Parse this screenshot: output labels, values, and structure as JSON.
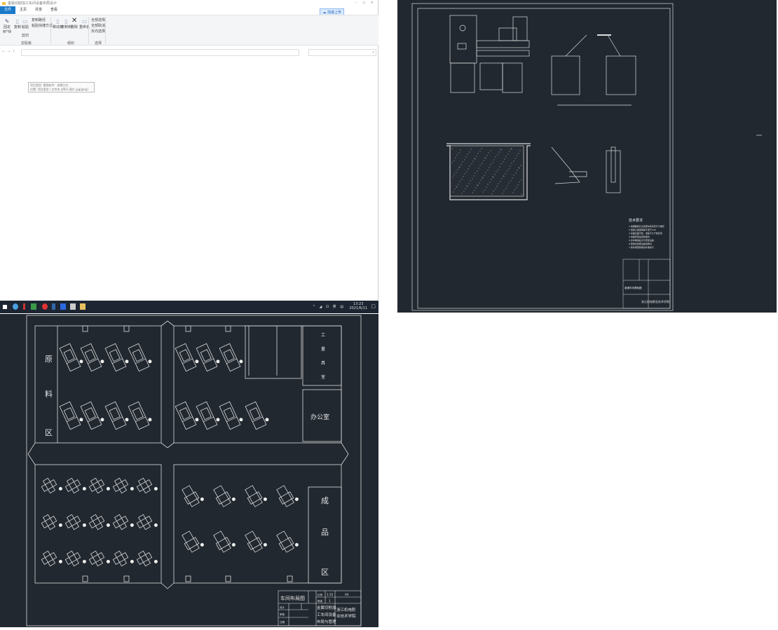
{
  "explorer": {
    "title": "金属切削加工车间设备布局设计",
    "tabs": [
      "文件",
      "主页",
      "共享",
      "查看"
    ],
    "ribbon": {
      "pin": "固定到\"快速访问\"",
      "copy": "复制",
      "paste": "粘贴",
      "copy_path": "复制路径",
      "paste_shortcut": "粘贴快捷方式",
      "cut": "剪切",
      "group_clipboard": "剪贴板",
      "move_to": "移动到",
      "copy_to": "复制到",
      "delete": "删除",
      "rename": "重命名",
      "group_organize": "组织",
      "select_all": "全部选择",
      "select_none": "全部取消",
      "invert": "反向选择",
      "group_select": "选择"
    },
    "upload_label": "加速上传",
    "tooltip": [
      "项目类型: 看图软件 · 创建方式",
      "位置: 项目类型 / 文件夹 (JPEG 图片 jpg/jpeg)"
    ]
  },
  "taskbar": {
    "time": "13:23",
    "date": "2021/6/11"
  },
  "layout_drawing": {
    "zones": {
      "raw": [
        "原",
        "料",
        "区"
      ],
      "finished": [
        "成",
        "品",
        "区"
      ],
      "office": "办公室",
      "tool_room": [
        "工",
        "量",
        "具",
        "室"
      ]
    },
    "title_block": {
      "drawing_name": "车间布局图",
      "scale_label": "比例",
      "scale": "1:10",
      "size": "A4",
      "qty_label": "数量",
      "qty": "1",
      "project": [
        "金属切削加",
        "工车间设备",
        "布局与管理"
      ],
      "school": [
        "浙江机电职",
        "业技术学院"
      ],
      "designer_label": "设计",
      "checker_label": "审核",
      "date_label": "日期"
    }
  },
  "foundation_drawing": {
    "tech_title": "技术要求",
    "tech_lines": [
      "1.地脚螺栓孔位置按车床实际尺寸确定",
      "2.混凝土强度等级不低于C20",
      "3.基础表面平整，误差不大于规定值",
      "4.基础周围设置防振沟",
      "5.养护期满后方可安装设备",
      "6.垫铁布置按设备说明书",
      "7.其余按国家相关标准执行"
    ],
    "school": "浙江机电职业技术学院",
    "drawing_name": "普通车床基础图"
  }
}
